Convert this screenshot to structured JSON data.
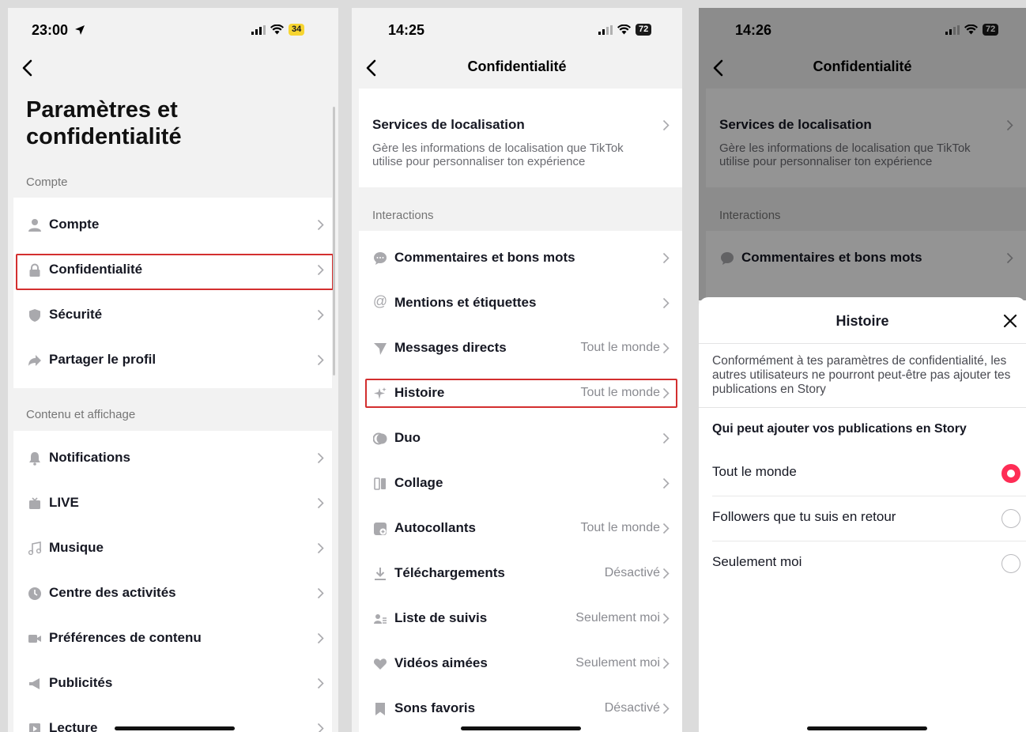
{
  "colors": {
    "accent": "#fe2c55",
    "highlight": "#d32f2f",
    "battery_yellow": "#f7d531"
  },
  "screen1": {
    "status": {
      "time": "23:00",
      "battery": "34"
    },
    "title": "Paramètres et confidentialité",
    "section_account": "Compte",
    "account_items": [
      {
        "label": "Compte",
        "icon": "person-icon"
      },
      {
        "label": "Confidentialité",
        "icon": "lock-icon"
      },
      {
        "label": "Sécurité",
        "icon": "shield-icon"
      },
      {
        "label": "Partager le profil",
        "icon": "share-icon"
      }
    ],
    "section_content": "Contenu et affichage",
    "content_items": [
      {
        "label": "Notifications",
        "icon": "bell-icon"
      },
      {
        "label": "LIVE",
        "icon": "live-tv-icon"
      },
      {
        "label": "Musique",
        "icon": "music-note-icon"
      },
      {
        "label": "Centre des activités",
        "icon": "clock-icon"
      },
      {
        "label": "Préférences de contenu",
        "icon": "video-camera-icon"
      },
      {
        "label": "Publicités",
        "icon": "megaphone-icon"
      },
      {
        "label": "Lecture",
        "icon": "play-icon"
      }
    ]
  },
  "screen2": {
    "status": {
      "time": "14:25",
      "battery": "72"
    },
    "nav_title": "Confidentialité",
    "location": {
      "title": "Services de localisation",
      "desc": "Gère les informations de localisation que TikTok utilise pour personnaliser ton expérience"
    },
    "section_interactions": "Interactions",
    "items": [
      {
        "label": "Commentaires et bons mots",
        "value": "",
        "icon": "comment-icon"
      },
      {
        "label": "Mentions et étiquettes",
        "value": "",
        "icon": "at-icon"
      },
      {
        "label": "Messages directs",
        "value": "Tout le monde",
        "icon": "send-icon"
      },
      {
        "label": "Histoire",
        "value": "Tout le monde",
        "icon": "sparkle-icon"
      },
      {
        "label": "Duo",
        "value": "",
        "icon": "duo-icon"
      },
      {
        "label": "Collage",
        "value": "",
        "icon": "collage-icon"
      },
      {
        "label": "Autocollants",
        "value": "Tout le monde",
        "icon": "sticker-icon"
      },
      {
        "label": "Téléchargements",
        "value": "Désactivé",
        "icon": "download-icon"
      },
      {
        "label": "Liste de suivis",
        "value": "Seulement moi",
        "icon": "following-icon"
      },
      {
        "label": "Vidéos aimées",
        "value": "Seulement moi",
        "icon": "heart-icon"
      },
      {
        "label": "Sons favoris",
        "value": "Désactivé",
        "icon": "bookmark-icon"
      }
    ]
  },
  "screen3": {
    "status": {
      "time": "14:26",
      "battery": "72"
    },
    "nav_title": "Confidentialité",
    "location": {
      "title": "Services de localisation",
      "desc": "Gère les informations de localisation que TikTok utilise pour personnaliser ton expérience"
    },
    "section_interactions": "Interactions",
    "item_comments": "Commentaires et bons mots",
    "sheet": {
      "title": "Histoire",
      "description": "Conformément à tes paramètres de confidentialité, les autres utilisateurs ne pourront peut-être pas ajouter tes publications en Story",
      "question": "Qui peut ajouter vos publications en Story",
      "options": [
        {
          "label": "Tout le monde",
          "selected": true
        },
        {
          "label": "Followers que tu suis en retour",
          "selected": false
        },
        {
          "label": "Seulement moi",
          "selected": false
        }
      ]
    }
  }
}
